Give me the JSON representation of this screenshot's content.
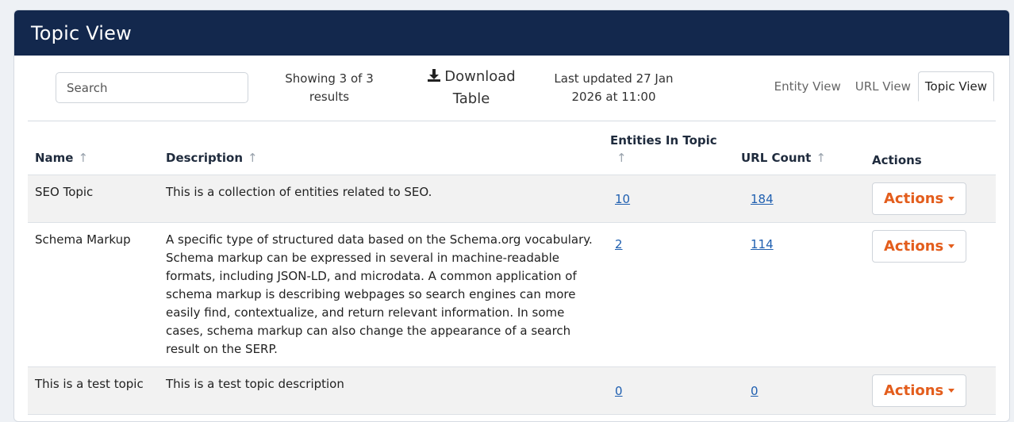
{
  "header": {
    "title": "Topic View"
  },
  "toolbar": {
    "search_placeholder": "Search",
    "showing_line1": "Showing 3 of 3",
    "showing_line2": "results",
    "download_line1": "Download",
    "download_line2": "Table",
    "download_icon": "download-icon",
    "updated_line1": "Last updated 27 Jan",
    "updated_line2": "2026 at 11:00",
    "views": [
      "Entity View",
      "URL View",
      "Topic View"
    ],
    "active_view": "Topic View"
  },
  "table": {
    "columns": {
      "name": "Name",
      "description": "Description",
      "entities": "Entities In Topic",
      "url_count": "URL Count",
      "actions": "Actions"
    },
    "sort_icon": "sort-up-arrow-icon",
    "rows": [
      {
        "name": "SEO Topic",
        "description": "This is a collection of entities related to SEO.",
        "entities": "10",
        "url_count": "184",
        "action_label": "Actions"
      },
      {
        "name": "Schema Markup",
        "description": "A specific type of structured data based on the Schema.org vocabulary. Schema markup can be expressed in several in machine-readable formats, including JSON-LD, and microdata. A common application of schema markup is describing webpages so search engines can more easily find, contextualize, and return relevant information. In some cases, schema markup can also change the appearance of a search result on the SERP.",
        "entities": "2",
        "url_count": "114",
        "action_label": "Actions"
      },
      {
        "name": "This is a test topic",
        "description": "This is a test topic description",
        "entities": "0",
        "url_count": "0",
        "action_label": "Actions"
      }
    ]
  },
  "colors": {
    "header_bg": "#13284d",
    "action_accent": "#e35d1c",
    "link": "#1f5fb0",
    "row_shade": "#f2f2f2"
  }
}
